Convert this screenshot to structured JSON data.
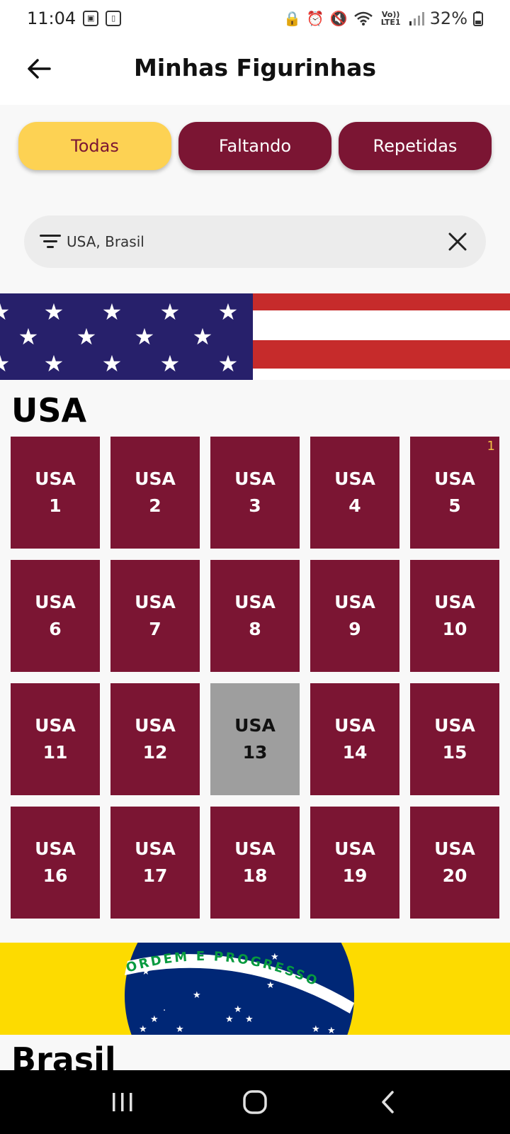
{
  "status_bar": {
    "time": "11:04",
    "battery": "32%",
    "network": "Vo)) LTE1"
  },
  "app_bar": {
    "title": "Minhas Figurinhas",
    "back_icon": "arrow-left-icon"
  },
  "filters": [
    {
      "label": "Todas",
      "active": true
    },
    {
      "label": "Faltando",
      "active": false
    },
    {
      "label": "Repetidas",
      "active": false
    }
  ],
  "search": {
    "value": "USA, Brasil",
    "filter_icon": "filter-icon",
    "clear_icon": "close-icon"
  },
  "colors": {
    "primary": "#7b1533",
    "accent": "#fdd253",
    "missing": "#9e9e9e",
    "count_badge": "#f1c044"
  },
  "sections": [
    {
      "title": "USA",
      "stickers": [
        {
          "code": "USA",
          "number": "1",
          "owned": true
        },
        {
          "code": "USA",
          "number": "2",
          "owned": true
        },
        {
          "code": "USA",
          "number": "3",
          "owned": true
        },
        {
          "code": "USA",
          "number": "4",
          "owned": true
        },
        {
          "code": "USA",
          "number": "5",
          "owned": true,
          "repeat_count": "1"
        },
        {
          "code": "USA",
          "number": "6",
          "owned": true
        },
        {
          "code": "USA",
          "number": "7",
          "owned": true
        },
        {
          "code": "USA",
          "number": "8",
          "owned": true
        },
        {
          "code": "USA",
          "number": "9",
          "owned": true
        },
        {
          "code": "USA",
          "number": "10",
          "owned": true
        },
        {
          "code": "USA",
          "number": "11",
          "owned": true
        },
        {
          "code": "USA",
          "number": "12",
          "owned": true
        },
        {
          "code": "USA",
          "number": "13",
          "owned": false
        },
        {
          "code": "USA",
          "number": "14",
          "owned": true
        },
        {
          "code": "USA",
          "number": "15",
          "owned": true
        },
        {
          "code": "USA",
          "number": "16",
          "owned": true
        },
        {
          "code": "USA",
          "number": "17",
          "owned": true
        },
        {
          "code": "USA",
          "number": "18",
          "owned": true
        },
        {
          "code": "USA",
          "number": "19",
          "owned": true
        },
        {
          "code": "USA",
          "number": "20",
          "owned": true
        }
      ]
    },
    {
      "title": "Brasil",
      "flag_motto": "ORDEM E PROGRESSO"
    }
  ],
  "nav_bar": {
    "recents_icon": "recents-icon",
    "home_icon": "home-icon",
    "back_icon": "back-chevron-icon"
  }
}
